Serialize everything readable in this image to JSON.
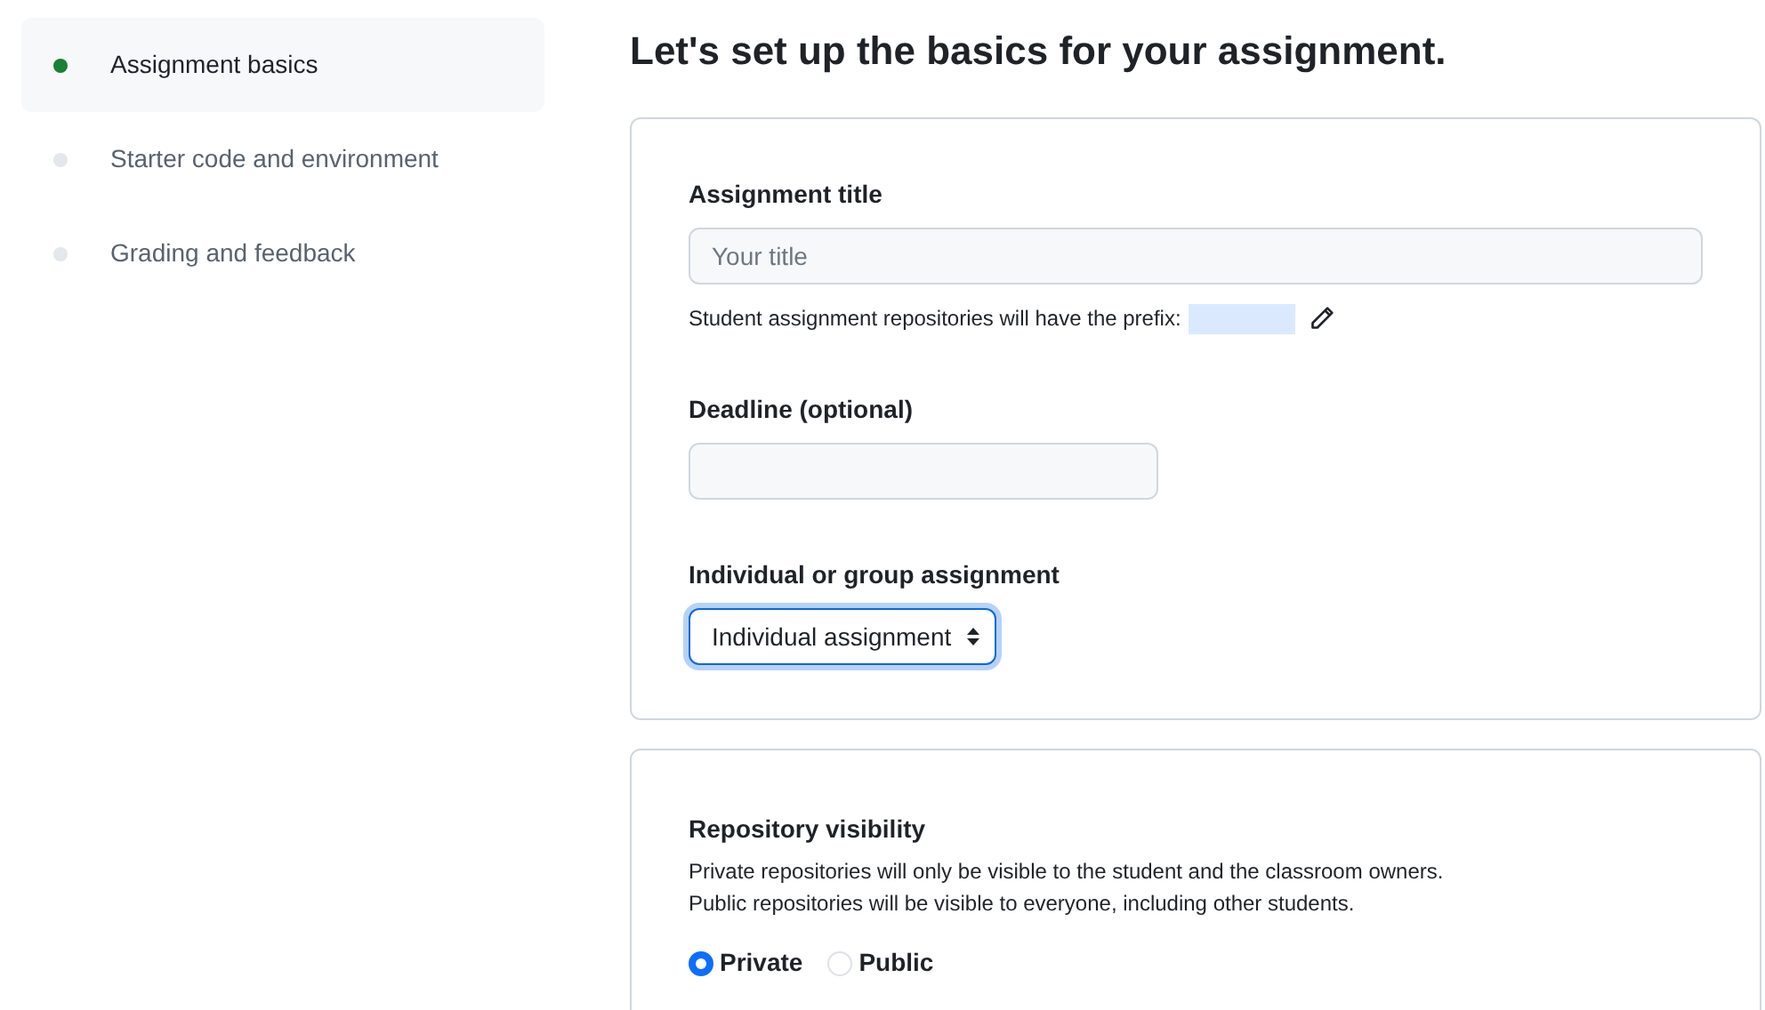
{
  "sidebar": {
    "items": [
      {
        "label": "Assignment basics",
        "selected": true
      },
      {
        "label": "Starter code and environment",
        "selected": false
      },
      {
        "label": "Grading and feedback",
        "selected": false
      }
    ]
  },
  "heading": "Let's set up the basics for your assignment.",
  "basics_card": {
    "title_field": {
      "label": "Assignment title",
      "placeholder": "Your title",
      "hint": "Student assignment repositories will have the prefix:"
    },
    "deadline_field": {
      "label": "Deadline (optional)"
    },
    "group_select": {
      "label": "Individual or group assignment",
      "value": "Individual assignment"
    }
  },
  "visibility_card": {
    "label": "Repository visibility",
    "description": [
      "Private repositories will only be visible to the student and the classroom owners.",
      "Public repositories will be visible to everyone, including other students."
    ],
    "options": [
      {
        "label": "Private",
        "selected": true
      },
      {
        "label": "Public",
        "selected": false
      }
    ]
  }
}
